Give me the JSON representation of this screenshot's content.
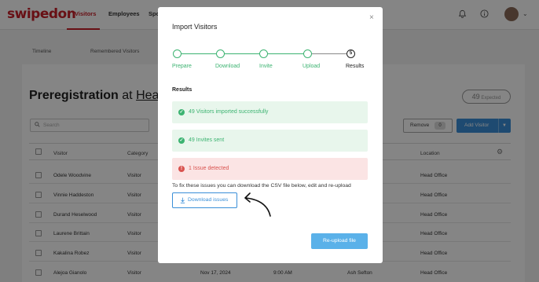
{
  "app": {
    "logo": "swipedon",
    "nav": [
      "Visitors",
      "Employees",
      "Spo"
    ],
    "active_nav": "Visitors"
  },
  "subtabs": [
    "Timeline",
    "Remembered Visitors"
  ],
  "page": {
    "title_prefix": "Preregistration",
    "title_at": "at",
    "title_location": "Head",
    "expected_count": "49",
    "expected_label": "Expected"
  },
  "toolbar": {
    "search_placeholder": "Search",
    "remove_label": "Remove",
    "remove_count": "0",
    "add_label": "Add Visitor"
  },
  "table": {
    "columns": [
      "Visitor",
      "Category",
      "Location"
    ],
    "rows": [
      {
        "visitor": "Odele Woodvine",
        "category": "Visitor",
        "date": "",
        "time": "",
        "host": "",
        "location": "Head Office"
      },
      {
        "visitor": "Vinnie Haddeston",
        "category": "Visitor",
        "date": "",
        "time": "",
        "host": "",
        "location": "Head Office"
      },
      {
        "visitor": "Durand Heselwood",
        "category": "Visitor",
        "date": "",
        "time": "",
        "host": "",
        "location": "Head Office"
      },
      {
        "visitor": "Laurene Brittain",
        "category": "Visitor",
        "date": "",
        "time": "",
        "host": "",
        "location": "Head Office"
      },
      {
        "visitor": "Kakalina Robez",
        "category": "Visitor",
        "date": "",
        "time": "",
        "host": "",
        "location": "Head Office"
      },
      {
        "visitor": "Alejoa Gianolo",
        "category": "Visitor",
        "date": "Nov 17, 2024",
        "time": "9:00 AM",
        "host": "Ash Sefton",
        "location": "Head Office"
      }
    ]
  },
  "modal": {
    "title": "Import Visitors",
    "close": "×",
    "steps": [
      {
        "label": "Prepare",
        "state": "done"
      },
      {
        "label": "Download",
        "state": "done"
      },
      {
        "label": "Invite",
        "state": "done"
      },
      {
        "label": "Upload",
        "state": "done"
      },
      {
        "label": "Results",
        "number": "5",
        "state": "current"
      }
    ],
    "results_heading": "Results",
    "banners": [
      {
        "type": "success",
        "text": "49 Visitors imported successfully"
      },
      {
        "type": "success",
        "text": "49 Invites sent"
      },
      {
        "type": "error",
        "text": "1 Issue detected"
      }
    ],
    "fix_text": "To fix these issues you can download the CSV file below, edit and re-upload",
    "download_label": "Download issues",
    "reupload_label": "Re-upload file"
  },
  "colors": {
    "brand": "#c8202a",
    "success": "#3cb371",
    "error": "#d9534f",
    "primary": "#3a8fd8"
  }
}
